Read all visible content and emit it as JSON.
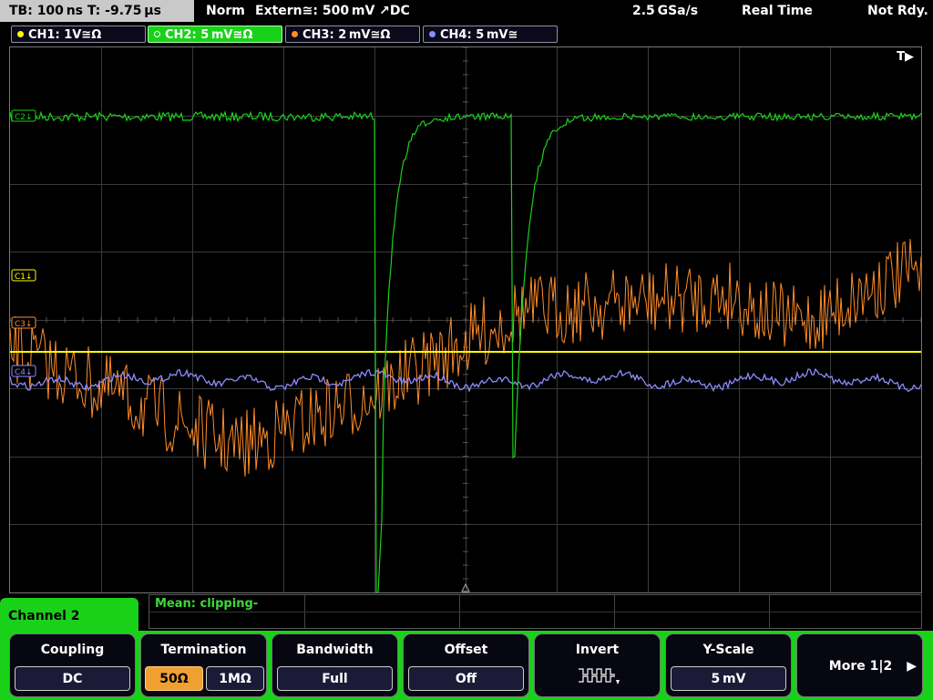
{
  "status": {
    "timebase": "TB: 100 ns   T: -9.75 µs",
    "acq_mode": "Norm",
    "trigger": "Extern≅: 500 mV ↗DC",
    "sample_rate": "2.5 GSa/s",
    "mode": "Real Time",
    "state": "Not Rdy."
  },
  "channel_tabs": [
    {
      "label": "CH1: 1V≅Ω",
      "color": "#ffff00"
    },
    {
      "label": "CH2: 5 mV≅Ω",
      "color": "#1ad11a"
    },
    {
      "label": "CH3: 2 mV≅Ω",
      "color": "#ff8c2a"
    },
    {
      "label": "CH4: 5 mV≅",
      "color": "#8c8cff"
    }
  ],
  "screen": {
    "trigger_marker": "T▶",
    "markers": [
      "C2↓",
      "C1↓",
      "C3↓",
      "C4↓"
    ]
  },
  "measure": {
    "text": "Mean: clipping-"
  },
  "menu": {
    "channel_label": "Channel 2",
    "coupling": {
      "label": "Coupling",
      "value": "DC"
    },
    "termination": {
      "label": "Termination",
      "options": [
        "50Ω",
        "1MΩ"
      ],
      "selected": "50Ω"
    },
    "bandwidth": {
      "label": "Bandwidth",
      "value": "Full"
    },
    "offset": {
      "label": "Offset",
      "value": "Off"
    },
    "invert": {
      "label": "Invert",
      "icon": "invert-pulse-icon"
    },
    "yscale": {
      "label": "Y-Scale",
      "value": "5 mV"
    },
    "more": {
      "label": "More 1|2",
      "icon": "arrow-right-icon"
    }
  },
  "colors": {
    "ch1": "#ffff00",
    "ch2": "#1ad11a",
    "ch3": "#ff8c2a",
    "ch4": "#8c8cff",
    "accent": "#f0a030"
  }
}
